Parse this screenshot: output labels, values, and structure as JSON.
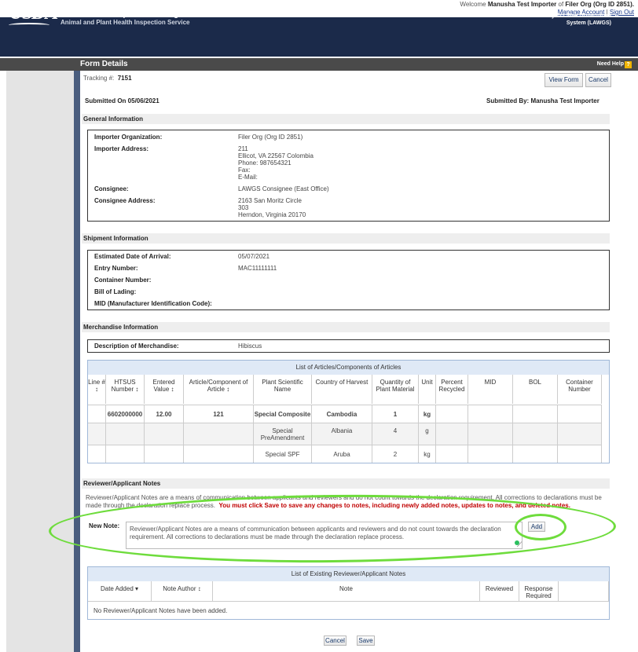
{
  "header": {
    "welcome_prefix": "Welcome",
    "user": "Manusha Test Importer",
    "of_text": "of",
    "org": "Filer Org (Org ID 2851).",
    "manage_account": "Manage Account",
    "separator": "|",
    "sign_out": "Sign Out"
  },
  "banner": {
    "logo": "USDA",
    "agency_line1": "United States Department of Agriculture",
    "agency_line2": "Animal and Plant Health Inspection Service",
    "system_line1": "Lacey Act Web Governance",
    "system_line2": "System (LAWGS)"
  },
  "titlebar": {
    "title": "Form Details",
    "help": "Need Help",
    "help_icon": "?"
  },
  "form": {
    "tracking_label": "Tracking #:",
    "tracking_value": "7151",
    "view_form": "View Form",
    "cancel": "Cancel",
    "submitted_on": "Submitted On 05/06/2021",
    "submitted_by": "Submitted By: Manusha Test Importer"
  },
  "general": {
    "header": "General Information",
    "importer_org_label": "Importer Organization:",
    "importer_org_value": "Filer Org (Org ID 2851)",
    "importer_addr_label": "Importer Address:",
    "importer_addr_lines": [
      "211",
      "Ellicot, VA 22567 Colombia",
      "Phone: 987654321",
      "Fax:",
      "E-Mail:"
    ],
    "consignee_label": "Consignee:",
    "consignee_value": "LAWGS Consignee (East Office)",
    "consignee_addr_label": "Consignee Address:",
    "consignee_addr_lines": [
      "2163 San Moritz Circle",
      "303",
      "Herndon, Virginia 20170"
    ]
  },
  "shipment": {
    "header": "Shipment Information",
    "eta_label": "Estimated Date of Arrival:",
    "eta_value": "05/07/2021",
    "entry_label": "Entry Number:",
    "entry_value": "MAC11111111",
    "container_label": "Container Number:",
    "bol_label": "Bill of Lading:",
    "mid_label": "MID (Manufacturer Identification Code):"
  },
  "merchandise": {
    "header": "Merchandise Information",
    "desc_label": "Description of Merchandise:",
    "desc_value": "Hibiscus"
  },
  "articles": {
    "title": "List of Articles/Components of Articles",
    "columns": [
      "Line # ↕",
      "HTSUS Number ↕",
      "Entered Value ↕",
      "Article/Component of Article ↕",
      "Plant Scientific Name",
      "Country of Harvest",
      "Quantity of Plant Material",
      "Unit",
      "Percent Recycled",
      "MID",
      "BOL",
      "Container Number"
    ],
    "rows": [
      [
        "",
        "6602000000",
        "12.00",
        "121",
        "Special Composite",
        "Cambodia",
        "1",
        "kg",
        "",
        "",
        "",
        ""
      ],
      [
        "",
        "",
        "",
        "",
        "Special PreAmendment",
        "Albania",
        "4",
        "g",
        "",
        "",
        "",
        ""
      ],
      [
        "",
        "",
        "",
        "",
        "Special SPF",
        "Aruba",
        "2",
        "kg",
        "",
        "",
        "",
        ""
      ]
    ]
  },
  "notes": {
    "header": "Reviewer/Applicant Notes",
    "desc": "Reviewer/Applicant Notes are a means of communication between applicants and reviewers and do not count towards the declaration requirement. All corrections to declarations must be made through the declaration replace process.",
    "warning": "You must click Save to save any changes to notes, including newly added notes, updates to notes, and deleted notes.",
    "new_note_label": "New Note:",
    "new_note_value": "Reviewer/Applicant Notes are a means of communication between applicants and reviewers and do not count towards the declaration requirement. All corrections to declarations must be made through the declaration replace process.",
    "add": "Add",
    "list_title": "List of Existing Reviewer/Applicant Notes",
    "columns": [
      "Date Added ▾",
      "Note Author ↕",
      "Note",
      "Reviewed",
      "Response Required",
      ""
    ],
    "empty": "No Reviewer/Applicant Notes have been added."
  },
  "footer": {
    "cancel": "Cancel",
    "save": "Save"
  },
  "colors": {
    "banner": "#1b2a4a",
    "highlight": "#6edc3c",
    "warning": "#c00000"
  }
}
